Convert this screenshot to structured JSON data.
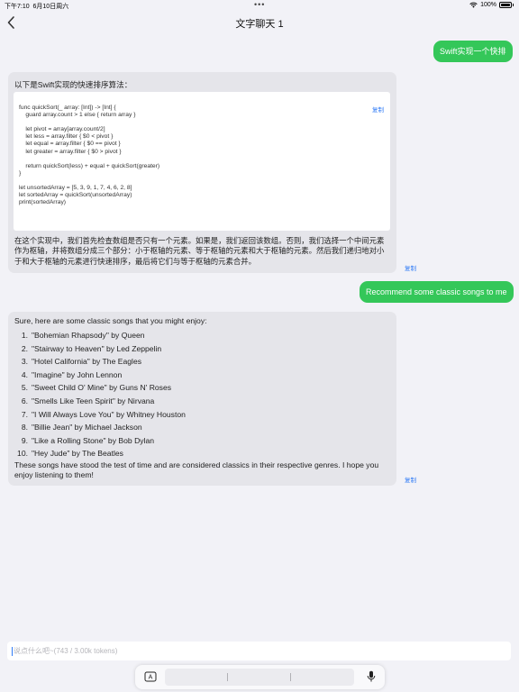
{
  "status_bar": {
    "time": "下午7:10",
    "date": "6月10日周六",
    "battery": "100%"
  },
  "nav": {
    "title": "文字聊天 1"
  },
  "messages": {
    "user1": "Swift实现一个快排",
    "bot1": {
      "intro": "以下是Swift实现的快速排序算法：",
      "copy_code": "复制",
      "code": "func quickSort(_ array: [Int]) -> [Int] {\n    guard array.count > 1 else { return array }\n\n    let pivot = array[array.count/2]\n    let less = array.filter { $0 < pivot }\n    let equal = array.filter { $0 == pivot }\n    let greater = array.filter { $0 > pivot }\n\n    return quickSort(less) + equal + quickSort(greater)\n}\n\nlet unsortedArray = [5, 3, 9, 1, 7, 4, 6, 2, 8]\nlet sortedArray = quickSort(unsortedArray)\nprint(sortedArray)",
      "explanation": "在这个实现中，我们首先检查数组是否只有一个元素。如果是，我们返回该数组。否则，我们选择一个中间元素作为枢轴，并将数组分成三个部分：小于枢轴的元素、等于枢轴的元素和大于枢轴的元素。然后我们递归地对小于和大于枢轴的元素进行快速排序，最后将它们与等于枢轴的元素合并。",
      "copy": "复制"
    },
    "user2": "Recommend some classic songs to me",
    "bot2": {
      "intro": "Sure, here are some classic songs that you might enjoy:",
      "songs": [
        "\"Bohemian Rhapsody\" by Queen",
        "\"Stairway to Heaven\" by Led Zeppelin",
        "\"Hotel California\" by The Eagles",
        "\"Imagine\" by John Lennon",
        "\"Sweet Child O' Mine\" by Guns N' Roses",
        "\"Smells Like Teen Spirit\" by Nirvana",
        "\"I Will Always Love You\" by Whitney Houston",
        "\"Billie Jean\" by Michael Jackson",
        "\"Like a Rolling Stone\" by Bob Dylan",
        "\"Hey Jude\" by The Beatles"
      ],
      "song_numbers": [
        "1.",
        "2.",
        "3.",
        "4.",
        "5.",
        "6.",
        "7.",
        "8.",
        "9.",
        "10."
      ],
      "outro": "These songs have stood the test of time and are considered classics in their respective genres. I hope you enjoy listening to them!",
      "copy": "复制"
    }
  },
  "composer": {
    "placeholder": "说点什么吧~(743 / 3.00k tokens)"
  },
  "colors": {
    "user_bubble": "#34c759",
    "link": "#2f7bf6"
  },
  "icons": {
    "back": "chevron-left-icon",
    "keyboard": "keyboard-a-icon",
    "mic": "microphone-icon",
    "wifi": "wifi-icon",
    "battery": "battery-icon"
  }
}
